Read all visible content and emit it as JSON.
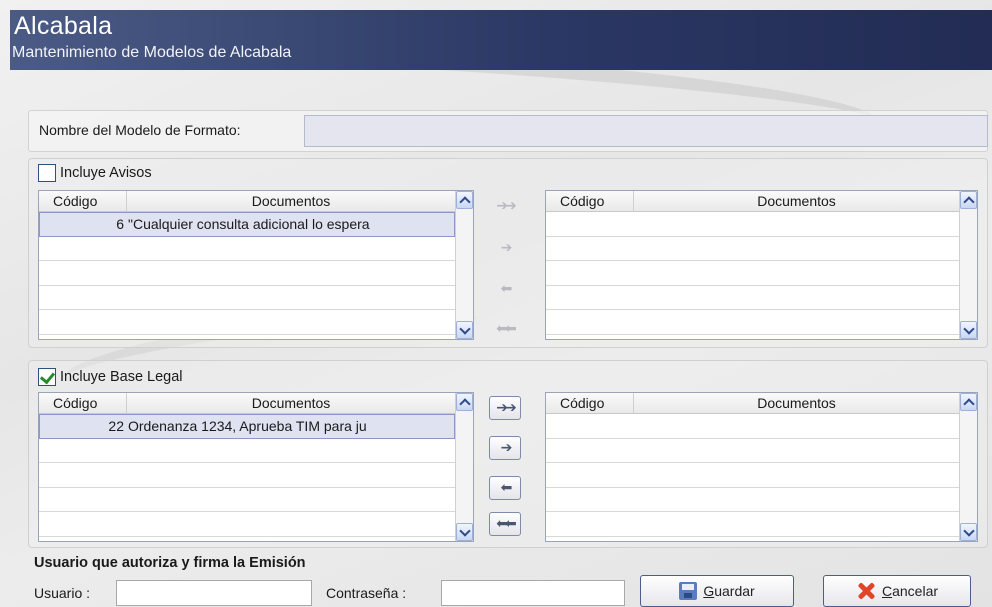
{
  "header": {
    "title": "Alcabala",
    "subtitle": "Mantenimiento de Modelos de Alcabala"
  },
  "model_name": {
    "label": "Nombre del Modelo de Formato:",
    "value": ""
  },
  "avisos": {
    "checkbox_label": "Incluye Avisos",
    "checked": false,
    "left_grid": {
      "columns": [
        "Código",
        "Documentos"
      ],
      "rows": [
        {
          "code": "6",
          "doc": "\"Cualquier consulta adicional lo espera"
        }
      ]
    },
    "right_grid": {
      "columns": [
        "Código",
        "Documentos"
      ],
      "rows": []
    },
    "move_buttons": [
      "move-all-right",
      "move-right",
      "move-left",
      "move-all-left"
    ],
    "move_enabled": false
  },
  "base_legal": {
    "checkbox_label": "Incluye Base Legal",
    "checked": true,
    "left_grid": {
      "columns": [
        "Código",
        "Documentos"
      ],
      "rows": [
        {
          "code": "22",
          "doc": "Ordenanza 1234, Aprueba TIM para ju"
        }
      ]
    },
    "right_grid": {
      "columns": [
        "Código",
        "Documentos"
      ],
      "rows": []
    },
    "move_buttons": [
      "move-all-right",
      "move-right",
      "move-left",
      "move-all-left"
    ],
    "move_enabled": true
  },
  "footer": {
    "title": "Usuario que autoriza y firma la Emisión",
    "user_label": "Usuario :",
    "user_value": "",
    "password_label": "Contraseña :",
    "password_value": "",
    "save_label": "Guardar",
    "save_accel": "G",
    "cancel_label": "Cancelar",
    "cancel_accel": "C"
  }
}
